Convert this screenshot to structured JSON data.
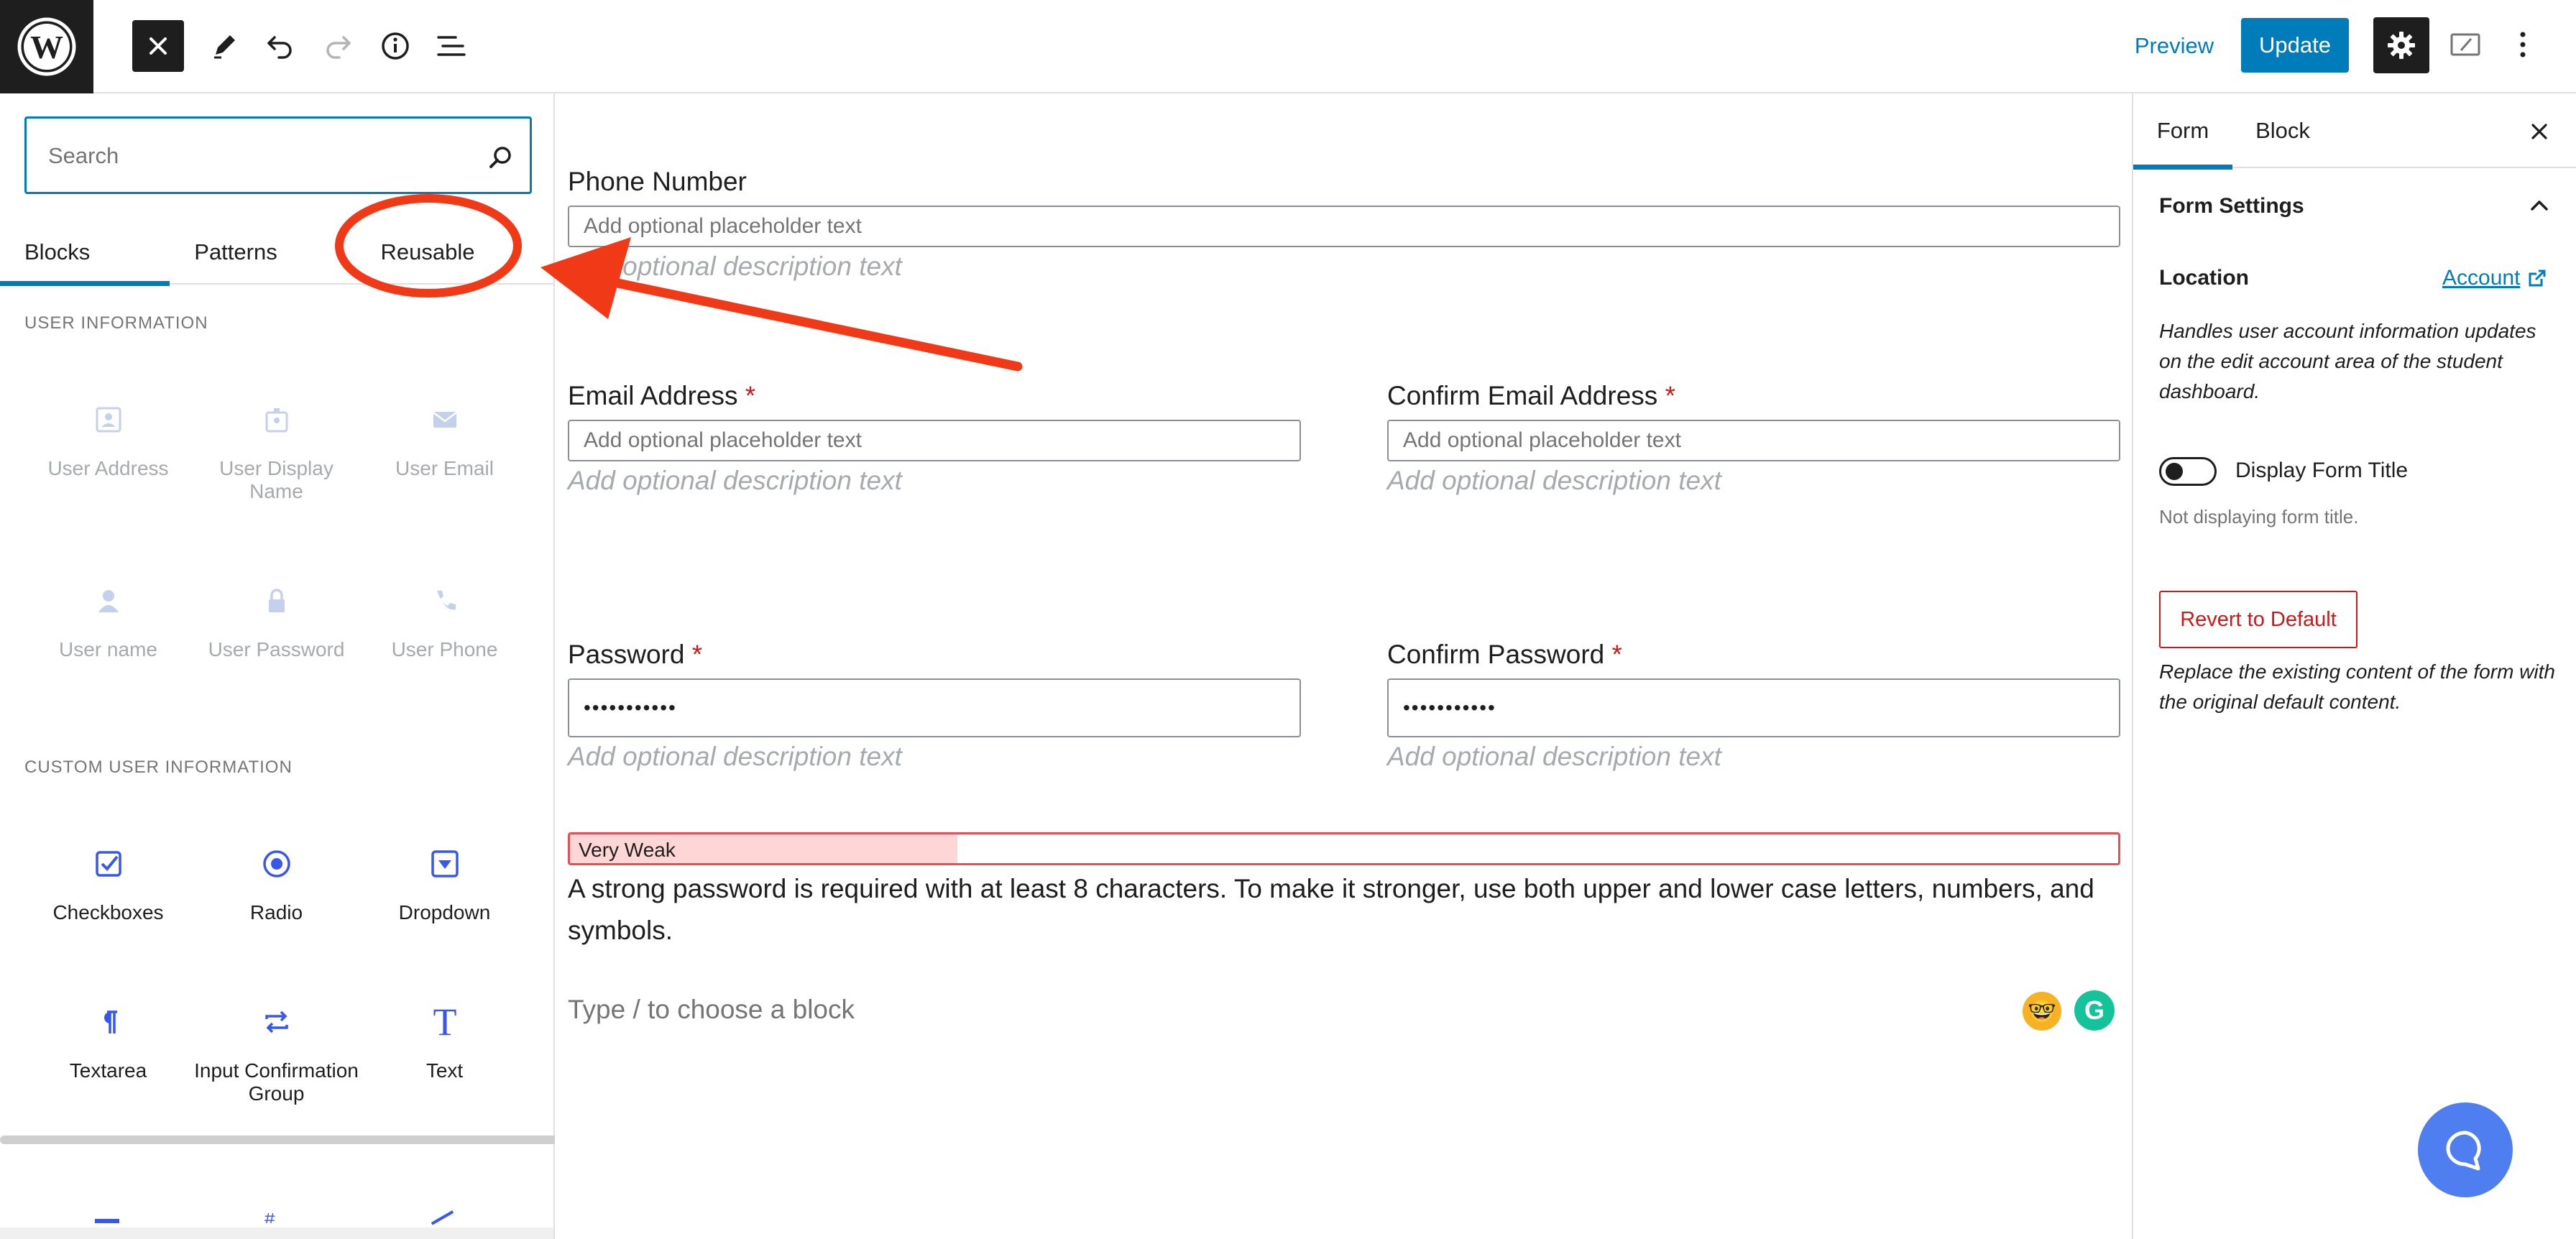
{
  "toolbar": {
    "preview_label": "Preview",
    "update_label": "Update"
  },
  "inserter": {
    "search_placeholder": "Search",
    "tabs": [
      "Blocks",
      "Patterns",
      "Reusable"
    ],
    "sections": [
      {
        "title": "USER INFORMATION",
        "items": [
          "User Address",
          "User Display Name",
          "User Email",
          "User name",
          "User Password",
          "User Phone"
        ]
      },
      {
        "title": "CUSTOM USER INFORMATION",
        "items": [
          "Checkboxes",
          "Radio",
          "Dropdown",
          "Textarea",
          "Input Confirmation Group",
          "Text"
        ]
      }
    ]
  },
  "form": {
    "phone": {
      "label": "Phone Number",
      "placeholder": "Add optional placeholder text",
      "description": "Add optional description text"
    },
    "email": {
      "label": "Email Address",
      "required_mark": "*",
      "placeholder": "Add optional placeholder text",
      "description": "Add optional description text"
    },
    "confirm_email": {
      "label": "Confirm Email Address",
      "required_mark": "*",
      "placeholder": "Add optional placeholder text",
      "description": "Add optional description text"
    },
    "password": {
      "label": "Password",
      "required_mark": "*",
      "value": "•••••••••••",
      "description": "Add optional description text"
    },
    "confirm_password": {
      "label": "Confirm Password",
      "required_mark": "*",
      "value": "•••••••••••",
      "description": "Add optional description text"
    },
    "strength": {
      "label": "Very Weak",
      "level": 0.25
    },
    "password_hint": "A strong password is required with at least 8 characters. To make it stronger, use both upper and lower case letters, numbers, and symbols.",
    "block_appender": "Type / to choose a block"
  },
  "sidebar": {
    "tabs": [
      "Form",
      "Block"
    ],
    "panel_title": "Form Settings",
    "location_label": "Location",
    "location_link": "Account",
    "location_note": "Handles user account information updates on the edit account area of the student dashboard.",
    "toggle_label": "Display Form Title",
    "toggle_on": false,
    "toggle_help": "Not displaying form title.",
    "revert_label": "Revert to Default",
    "revert_note": "Replace the existing content of the form with the original default content."
  },
  "colors": {
    "accent": "#007cba",
    "annotation": "#f03a17",
    "danger": "#cc1818",
    "help_bubble": "#4e7ef0"
  }
}
